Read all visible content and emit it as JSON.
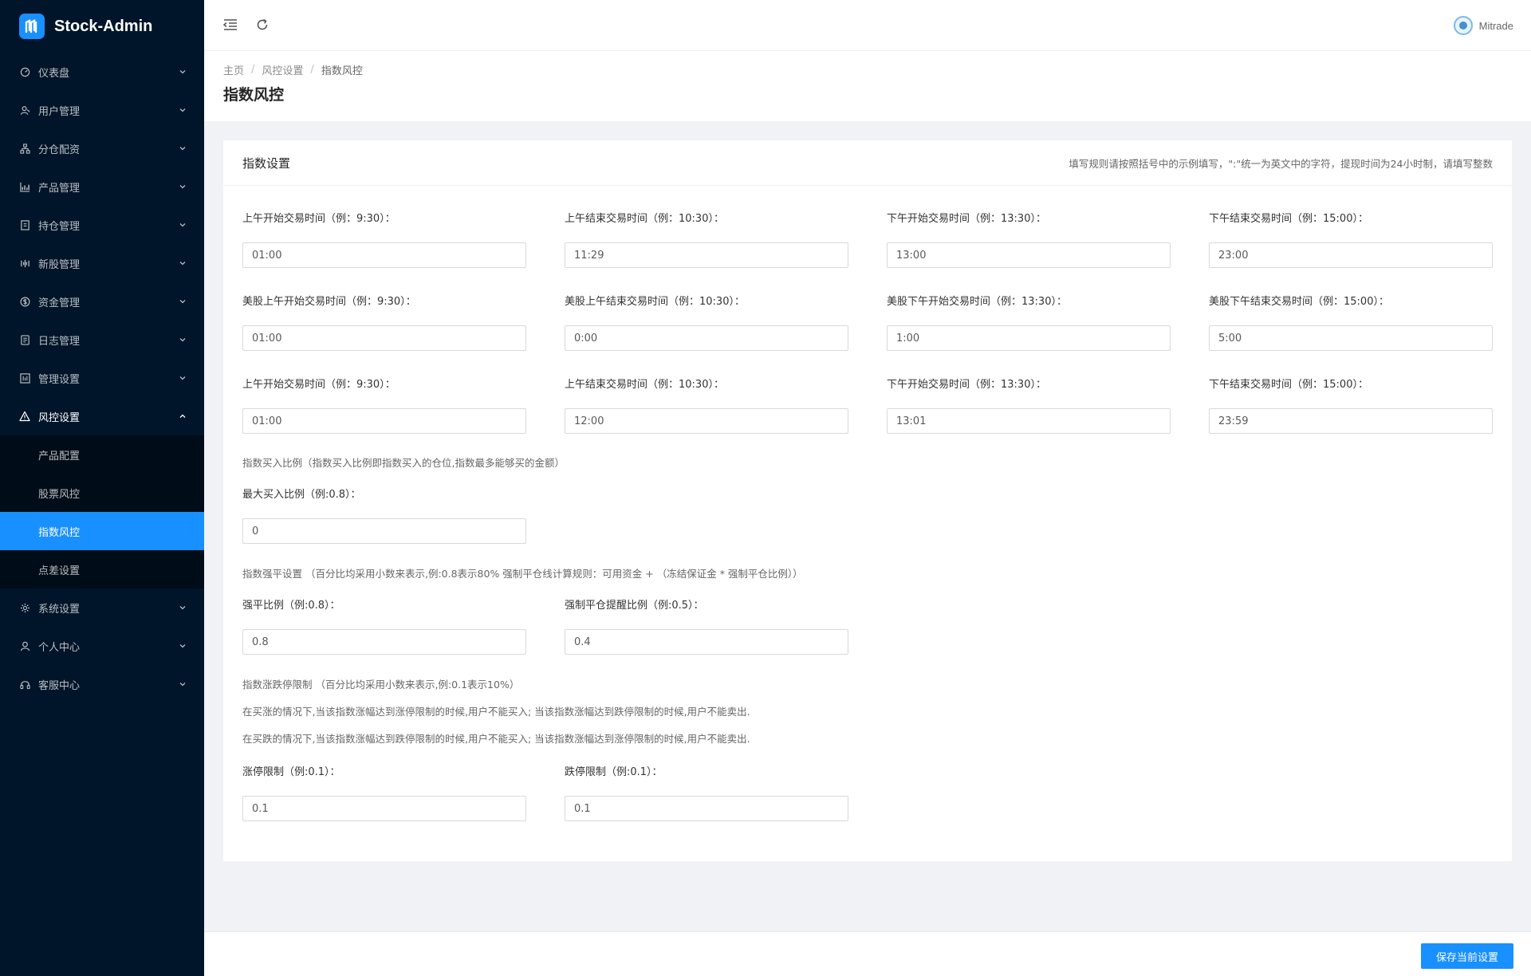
{
  "app": {
    "title": "Stock-Admin"
  },
  "colors": {
    "sidebar_bg": "#001529",
    "accent": "#1890ff"
  },
  "sidebar": {
    "items": [
      {
        "label": "仪表盘",
        "icon": "dashboard-icon"
      },
      {
        "label": "用户管理",
        "icon": "user-manage-icon"
      },
      {
        "label": "分仓配资",
        "icon": "network-icon"
      },
      {
        "label": "产品管理",
        "icon": "chart-icon"
      },
      {
        "label": "持仓管理",
        "icon": "position-icon"
      },
      {
        "label": "新股管理",
        "icon": "bars-icon"
      },
      {
        "label": "资金管理",
        "icon": "dollar-icon"
      },
      {
        "label": "日志管理",
        "icon": "log-icon"
      },
      {
        "label": "管理设置",
        "icon": "settings-board-icon"
      },
      {
        "label": "风控设置",
        "icon": "warning-icon",
        "open": true,
        "children": [
          "产品配置",
          "股票风控",
          "指数风控",
          "点差设置"
        ],
        "active_child": "指数风控"
      },
      {
        "label": "系统设置",
        "icon": "gear-icon"
      },
      {
        "label": "个人中心",
        "icon": "person-icon"
      },
      {
        "label": "客服中心",
        "icon": "headset-icon"
      }
    ]
  },
  "header": {
    "user_name": "Mitrade"
  },
  "breadcrumb": [
    "主页",
    "风控设置",
    "指数风控"
  ],
  "page_title": "指数风控",
  "card": {
    "title": "指数设置",
    "hint": "填写规则请按照括号中的示例填写，\":\"统一为英文中的字符，提现时间为24小时制，请填写整数",
    "row1": [
      {
        "label": "上午开始交易时间（例：9:30）：",
        "value": "01:00"
      },
      {
        "label": "上午结束交易时间（例：10:30）：",
        "value": "11:29"
      },
      {
        "label": "下午开始交易时间（例：13:30）：",
        "value": "13:00"
      },
      {
        "label": "下午结束交易时间（例：15:00）：",
        "value": "23:00"
      }
    ],
    "row2": [
      {
        "label": "美股上午开始交易时间（例：9:30）：",
        "value": "01:00"
      },
      {
        "label": "美股上午结束交易时间（例：10:30）：",
        "value": "0:00"
      },
      {
        "label": "美股下午开始交易时间（例：13:30）：",
        "value": "1:00"
      },
      {
        "label": "美股下午结束交易时间（例：15:00）：",
        "value": "5:00"
      }
    ],
    "row3": [
      {
        "label": "上午开始交易时间（例：9:30）：",
        "value": "01:00"
      },
      {
        "label": "上午结束交易时间（例：10:30）：",
        "value": "12:00"
      },
      {
        "label": "下午开始交易时间（例：13:30）：",
        "value": "13:01"
      },
      {
        "label": "下午结束交易时间（例：15:00）：",
        "value": "23:59"
      }
    ],
    "buy_ratio_note": "指数买入比例（指数买入比例即指数买入的仓位,指数最多能够买的金额）",
    "max_buy": {
      "label": "最大买入比例（例:0.8）：",
      "value": "0"
    },
    "force_note": "指数强平设置 （百分比均采用小数来表示,例:0.8表示80% 强制平仓线计算规则：可用资金 + （冻结保证金 * 强制平仓比例））",
    "force_ratio": {
      "label": "强平比例（例:0.8）：",
      "value": "0.8"
    },
    "force_warn": {
      "label": "强制平仓提醒比例（例:0.5）：",
      "value": "0.4"
    },
    "limit_note1": "指数涨跌停限制 （百分比均采用小数来表示,例:0.1表示10%）",
    "limit_note2": "在买涨的情况下,当该指数涨幅达到涨停限制的时候,用户不能买入; 当该指数涨幅达到跌停限制的时候,用户不能卖出.",
    "limit_note3": "在买跌的情况下,当该指数涨幅达到跌停限制的时候,用户不能买入; 当该指数涨幅达到涨停限制的时候,用户不能卖出.",
    "limit_up": {
      "label": "涨停限制（例:0.1）：",
      "value": "0.1"
    },
    "limit_down": {
      "label": "跌停限制（例:0.1）：",
      "value": "0.1"
    }
  },
  "footer": {
    "save_label": "保存当前设置"
  }
}
